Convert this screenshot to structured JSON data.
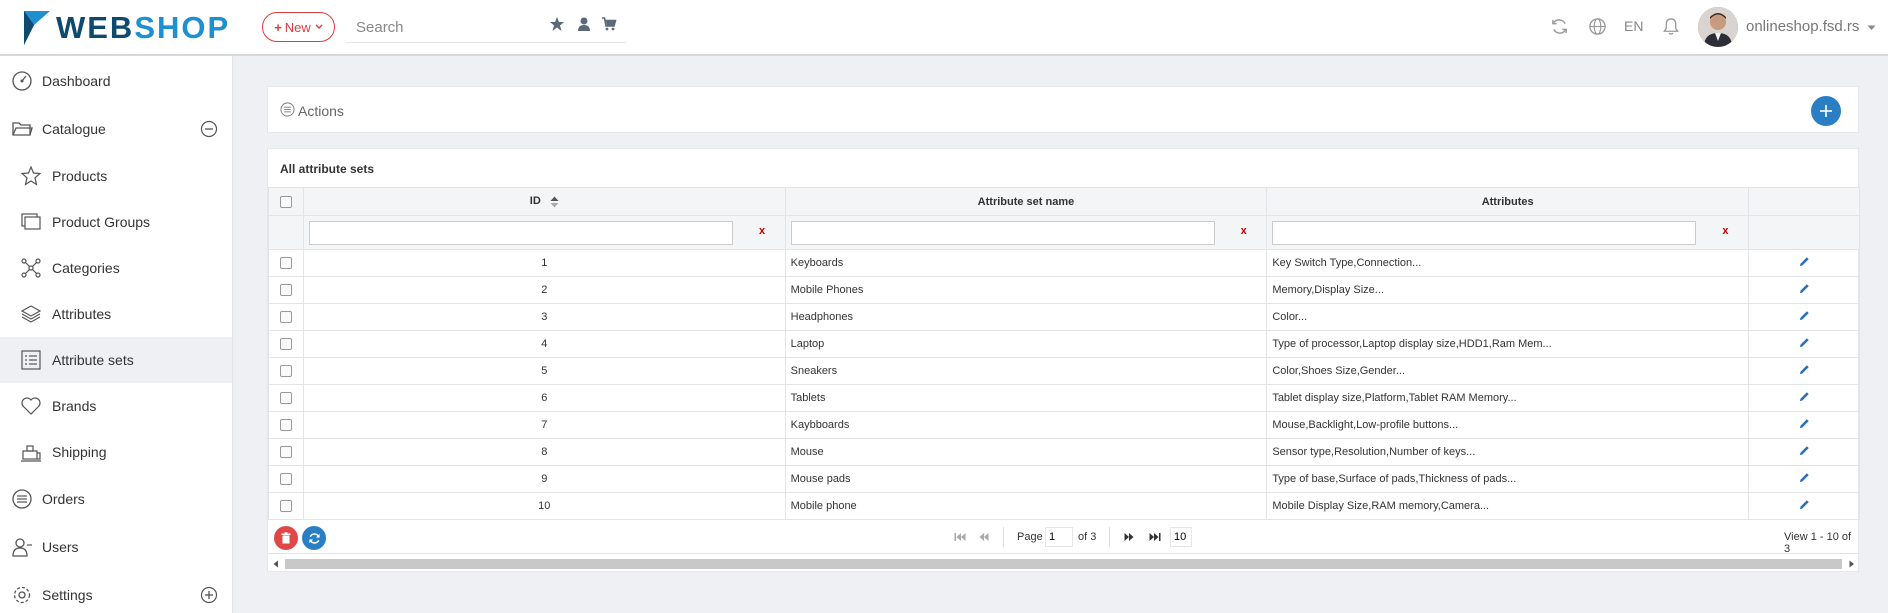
{
  "header": {
    "logo_part1": "WEB",
    "logo_part2": "SHOP",
    "new_label": "New",
    "search_placeholder": "Search",
    "lang": "EN",
    "user": "onlineshop.fsd.rs"
  },
  "sidebar": {
    "items": [
      {
        "label": "Dashboard",
        "icon": "dashboard-icon"
      },
      {
        "label": "Catalogue",
        "icon": "folder-icon"
      },
      {
        "label": "Products",
        "icon": "star-icon"
      },
      {
        "label": "Product Groups",
        "icon": "product-groups-icon"
      },
      {
        "label": "Categories",
        "icon": "categories-icon"
      },
      {
        "label": "Attributes",
        "icon": "layers-icon"
      },
      {
        "label": "Attribute sets",
        "icon": "list-icon"
      },
      {
        "label": "Brands",
        "icon": "heart-icon"
      },
      {
        "label": "Shipping",
        "icon": "shipping-icon"
      },
      {
        "label": "Orders",
        "icon": "orders-icon"
      },
      {
        "label": "Users",
        "icon": "users-icon"
      },
      {
        "label": "Settings",
        "icon": "settings-icon"
      }
    ]
  },
  "actions": {
    "label": "Actions"
  },
  "grid": {
    "title": "All attribute sets",
    "columns": {
      "id": "ID",
      "name": "Attribute set name",
      "attributes": "Attributes"
    },
    "filter_clear": "x",
    "rows": [
      {
        "id": "1",
        "name": "Keyboards",
        "attributes": "Key Switch Type,Connection..."
      },
      {
        "id": "2",
        "name": "Mobile Phones",
        "attributes": "Memory,Display Size..."
      },
      {
        "id": "3",
        "name": "Headphones",
        "attributes": "Color..."
      },
      {
        "id": "4",
        "name": "Laptop",
        "attributes": "Type of processor,Laptop display size,HDD1,Ram Mem..."
      },
      {
        "id": "5",
        "name": "Sneakers",
        "attributes": "Color,Shoes Size,Gender..."
      },
      {
        "id": "6",
        "name": "Tablets",
        "attributes": "Tablet display size,Platform,Tablet RAM Memory..."
      },
      {
        "id": "7",
        "name": "Kaybboards",
        "attributes": "Mouse,Backlight,Low-profile buttons..."
      },
      {
        "id": "8",
        "name": "Mouse",
        "attributes": "Sensor type,Resolution,Number of keys..."
      },
      {
        "id": "9",
        "name": "Mouse pads",
        "attributes": "Type of base,Surface of pads,Thickness of pads..."
      },
      {
        "id": "10",
        "name": "Mobile phone",
        "attributes": "Mobile Display Size,RAM memory,Camera..."
      }
    ],
    "pager": {
      "page_label": "Page",
      "page_value": "1",
      "of_label": "of 3",
      "rows_per_page": "10",
      "view_text": "View 1 - 10 of 3"
    }
  },
  "colors": {
    "accent": "#2a7fc4",
    "danger": "#e04848",
    "brand_dark": "#0e4a6e",
    "brand_light": "#1e8fd0"
  }
}
